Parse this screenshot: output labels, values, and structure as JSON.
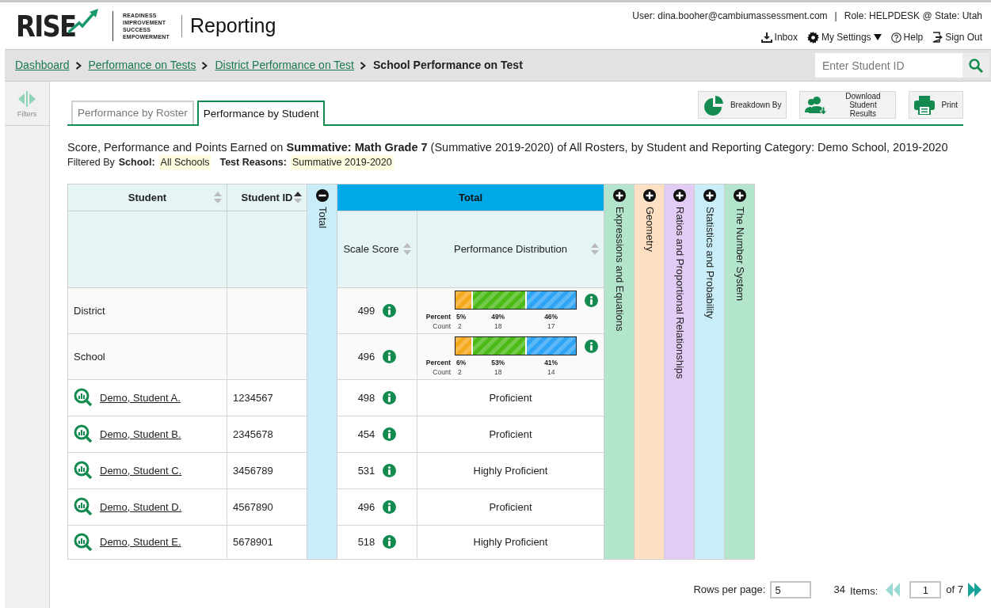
{
  "header": {
    "logo": {
      "wordmark": "RISE",
      "tagline": [
        "READINESS",
        "IMPROVEMENT",
        "SUCCESS",
        "EMPOWERMENT"
      ]
    },
    "app_title": "Reporting",
    "user": "User: dina.booher@cambiumassessment.com",
    "separator": "|",
    "role": "Role: HELPDESK @ State: Utah",
    "links": [
      {
        "kind": "inbox",
        "label": "Inbox"
      },
      {
        "kind": "settings",
        "label": "My Settings"
      },
      {
        "kind": "help",
        "label": "Help"
      },
      {
        "kind": "signout",
        "label": "Sign Out"
      }
    ]
  },
  "breadcrumb": [
    {
      "label": "Dashboard",
      "current": false
    },
    {
      "label": "Performance on Tests",
      "current": false
    },
    {
      "label": "District Performance on Test",
      "current": false
    },
    {
      "label": "School Performance on Test",
      "current": true
    }
  ],
  "student_search": {
    "placeholder": "Enter Student ID"
  },
  "sidebar": {
    "label": "Filters"
  },
  "tabs": [
    {
      "label": "Performance by Roster",
      "selected": false
    },
    {
      "label": "Performance by Student",
      "selected": true
    }
  ],
  "toolbar": [
    {
      "kind": "breakdown",
      "label": "Breakdown By"
    },
    {
      "kind": "download",
      "label": "Download Student Results"
    },
    {
      "kind": "print",
      "label": "Print"
    }
  ],
  "heading": "Score, Performance and Points Earned on **Summative: Math Grade 7** (Summative 2019-2020) of All Rosters, by Student and Reporting Category: Demo School, 2019-2020",
  "filters": {
    "label": "Filtered By",
    "items": [
      {
        "name": "School:",
        "value": "All Schools"
      },
      {
        "name": "Test Reasons:",
        "value": "Summative 2019-2020"
      }
    ]
  },
  "table": {
    "columns": [
      {
        "label": "Student",
        "sorted_ascending": false
      },
      {
        "label": "Student ID",
        "sorted_ascending": true
      }
    ],
    "groups": [
      {
        "label": "Total",
        "expanded": true,
        "color": "#c9eefa",
        "header": "Total",
        "columns": [
          {
            "label": "Scale Score",
            "sorted_ascending": false
          },
          {
            "label": "Performance Distribution",
            "sorted_ascending": false
          }
        ]
      },
      {
        "label": "Expressions and Equations",
        "expanded": false,
        "color": "#b3e4cc"
      },
      {
        "label": "Geometry",
        "expanded": false,
        "color": "#fde0c2"
      },
      {
        "label": "Ratios and Proportional Relationships",
        "expanded": false,
        "color": "#e2ccf5"
      },
      {
        "label": "Statistics and Probability",
        "expanded": false,
        "color": "#c9eefa"
      },
      {
        "label": "The Number System",
        "expanded": false,
        "color": "#b3e4cc"
      }
    ],
    "rows": [
      {
        "kind": "aggregate",
        "name": "District",
        "score": "499",
        "distribution": {
          "percent_label": "Percent",
          "count_label": "Count",
          "segments": [
            {
              "percent": "5%",
              "count": "2",
              "color": "#f5a81c"
            },
            {
              "percent": "49%",
              "count": "18",
              "color": "#4cbb17"
            },
            {
              "percent": "46%",
              "count": "17",
              "color": "#2fa4f5"
            }
          ]
        }
      },
      {
        "kind": "aggregate",
        "name": "School",
        "score": "496",
        "distribution": {
          "percent_label": "Percent",
          "count_label": "Count",
          "segments": [
            {
              "percent": "6%",
              "count": "2",
              "color": "#f5a81c"
            },
            {
              "percent": "53%",
              "count": "18",
              "color": "#4cbb17"
            },
            {
              "percent": "41%",
              "count": "14",
              "color": "#2fa4f5"
            }
          ]
        }
      },
      {
        "kind": "student",
        "name": "Demo, Student A.",
        "id": "1234567",
        "score": "498",
        "performance": "Proficient"
      },
      {
        "kind": "student",
        "name": "Demo, Student B.",
        "id": "2345678",
        "score": "454",
        "performance": "Proficient"
      },
      {
        "kind": "student",
        "name": "Demo, Student C.",
        "id": "3456789",
        "score": "531",
        "performance": "Highly Proficient"
      },
      {
        "kind": "student",
        "name": "Demo, Student D.",
        "id": "4567890",
        "score": "496",
        "performance": "Proficient"
      },
      {
        "kind": "student",
        "name": "Demo, Student E.",
        "id": "5678901",
        "score": "518",
        "performance": "Highly Proficient"
      }
    ]
  },
  "pagination": {
    "rows_label": "Rows per page:",
    "rows_value": "5",
    "count": "34",
    "items_label": "Items:",
    "page_value": "1",
    "of_label": "of 7",
    "prev_disabled": true,
    "next_disabled": false
  }
}
